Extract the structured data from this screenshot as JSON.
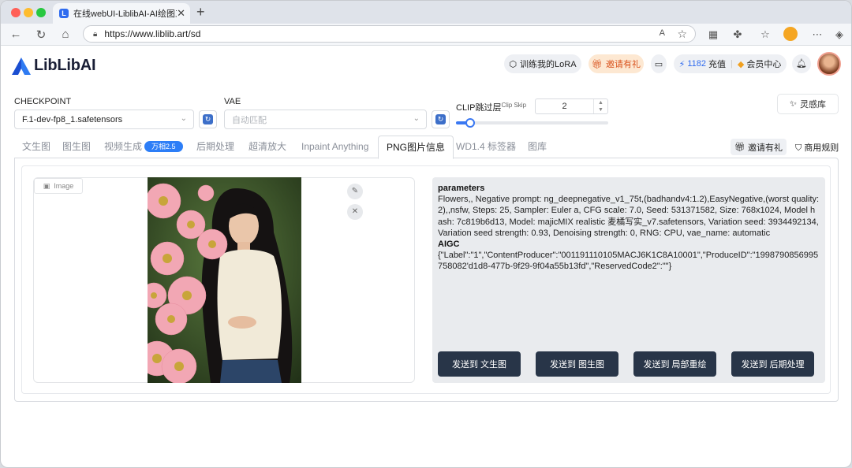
{
  "browser": {
    "tab_title": "在线webUI-LiblibAI-AI绘图工具",
    "tab_close": "✕",
    "new_tab": "+",
    "url": "https://www.liblib.art/sd",
    "read_aloud": "A",
    "favorite": "☆"
  },
  "header": {
    "logo_text": "LibLibAI",
    "train_lora": "训练我的LoRA",
    "invite": "邀请有礼",
    "points": "1182",
    "recharge": "充值",
    "member_center": "会员中心"
  },
  "controls": {
    "checkpoint_label": "CHECKPOINT",
    "checkpoint_value": "F.1-dev-fp8_1.safetensors",
    "vae_label": "VAE",
    "vae_placeholder": "自动匹配",
    "clip_label": "CLIP跳过层",
    "clip_sub": "Clip Skip",
    "clip_value": "2",
    "clip_slider_value": 2,
    "clip_slider_max": 12,
    "inspiration": "灵感库"
  },
  "tabs": [
    {
      "label": "文生图"
    },
    {
      "label": "图生图"
    },
    {
      "label": "视频生成",
      "badge": "万相2.5"
    },
    {
      "label": "后期处理"
    },
    {
      "label": "超清放大"
    },
    {
      "label": "Inpaint Anything"
    },
    {
      "label": "PNG图片信息",
      "active": true
    },
    {
      "label": "WD1.4 标签器"
    },
    {
      "label": "图库"
    }
  ],
  "toolbar": {
    "invite": "邀请有礼",
    "commercial_rules": "商用规则"
  },
  "image_panel": {
    "label": "Image",
    "edit_icon": "✎",
    "close_icon": "✕"
  },
  "info": {
    "parameters_heading": "parameters",
    "parameters_text": "Flowers,, Negative prompt: ng_deepnegative_v1_75t,(badhandv4:1.2),EasyNegative,(worst quality:2),,nsfw, Steps: 25, Sampler: Euler a, CFG scale: 7.0, Seed: 531371582, Size: 768x1024, Model hash: 7c819b6d13, Model: majicMIX realistic 麦橘写实_v7.safetensors, Variation seed: 3934492134, Variation seed strength: 0.93, Denoising strength: 0, RNG: CPU, vae_name: automatic",
    "aigc_heading": "AIGC",
    "aigc_text": "{\"Label\":\"1\",\"ContentProducer\":\"001191110105MACJ6K1C8A10001\",\"ProduceID\":\"1998790856995758082'd1d8-477b-9f29-9f04a55b13fd\",\"ReservedCode2\":\"\"}"
  },
  "send_buttons": [
    "发送到 文生图",
    "发送到 图生图",
    "发送到 局部重绘",
    "发送到 后期处理"
  ],
  "colors": {
    "accent": "#3a78f2",
    "dark_button": "#283548",
    "badge": "#2d7ef7",
    "invite_pill": "#fde8d2"
  }
}
